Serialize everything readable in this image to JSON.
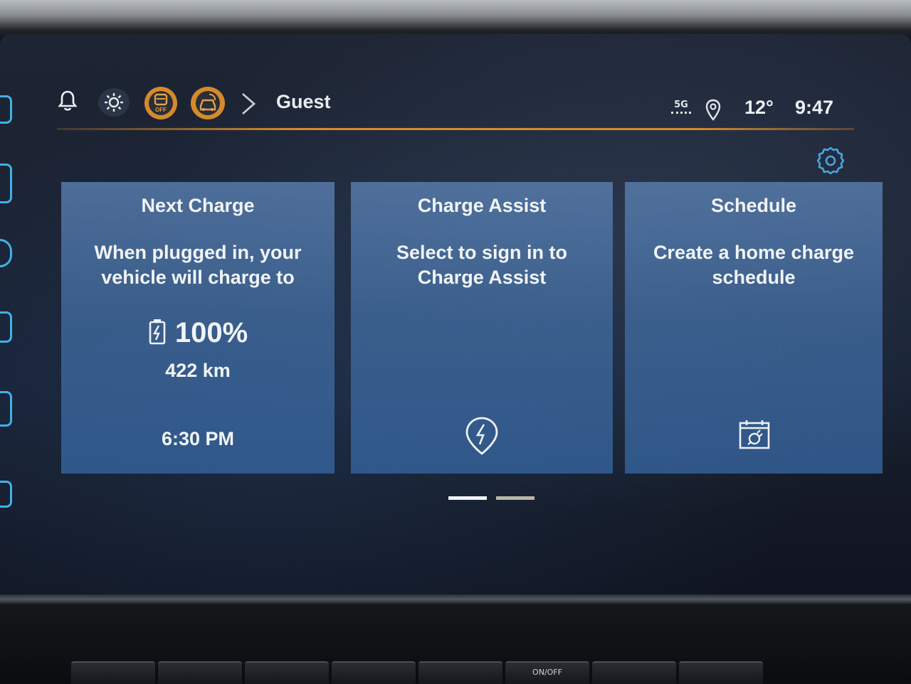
{
  "status_bar": {
    "breadcrumb": "Guest",
    "signal": "5G",
    "temperature": "12°",
    "time": "9:47"
  },
  "cards": [
    {
      "title": "Next Charge",
      "line1": "When plugged in, your",
      "line2": "vehicle will charge to",
      "percent": "100%",
      "range": "422 km",
      "time": "6:30 PM"
    },
    {
      "title": "Charge Assist",
      "line1": "Select to sign in to",
      "line2": "Charge Assist",
      "icon": "charge-pin-icon"
    },
    {
      "title": "Schedule",
      "line1": "Create a home charge",
      "line2": "schedule",
      "icon": "calendar-plug-icon"
    }
  ],
  "pager": {
    "pages": 2,
    "current": 1
  },
  "console": {
    "button_label": "ON/OFF"
  },
  "colors": {
    "accent": "#d68a2a",
    "card": "#4a7bb4",
    "rail": "#3fb2e6"
  }
}
